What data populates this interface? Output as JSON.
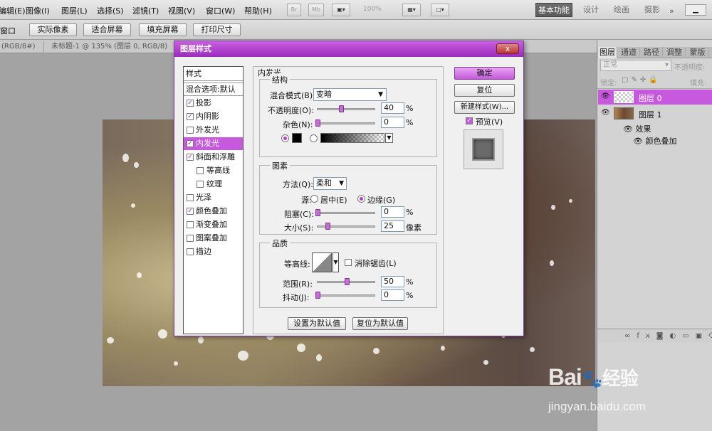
{
  "menubar": {
    "items": [
      "编辑(E)",
      "图像(I)",
      "图层(L)",
      "选择(S)",
      "滤镜(T)",
      "视图(V)",
      "窗口(W)",
      "帮助(H)"
    ],
    "zoom": "100%",
    "workspaces": [
      "基本功能",
      "设计",
      "绘画",
      "摄影"
    ]
  },
  "options": {
    "left_label": "窗口",
    "buttons": [
      "实际像素",
      "适合屏幕",
      "填充屏幕",
      "打印尺寸"
    ]
  },
  "tabs": {
    "first": "(RGB/8#)",
    "second": "未标题-1 @ 135% (图层 0, RGB/8)"
  },
  "panel": {
    "tabs": [
      "图层",
      "通道",
      "路径",
      "调整",
      "蒙版"
    ],
    "blend": "正常",
    "opacity_label": "不透明度:",
    "lock_label": "锁定:",
    "fill_label": "填充:",
    "layers": [
      {
        "name": "图层 0"
      },
      {
        "name": "图层 1"
      }
    ],
    "effects_label": "效果",
    "effect_item": "颜色叠加",
    "footer_icons": [
      "link-icon",
      "fx-icon",
      "mask-icon",
      "adjustment-icon",
      "folder-icon",
      "new-layer-icon",
      "trash-icon"
    ]
  },
  "dialog": {
    "title": "图层样式",
    "close": "x",
    "styles_header": "样式",
    "blend_options": "混合选项:默认",
    "items": [
      {
        "label": "投影",
        "checked": true,
        "sub": false
      },
      {
        "label": "内阴影",
        "checked": true,
        "sub": false
      },
      {
        "label": "外发光",
        "checked": false,
        "sub": false
      },
      {
        "label": "内发光",
        "checked": true,
        "sub": false,
        "selected": true
      },
      {
        "label": "斜面和浮雕",
        "checked": true,
        "sub": false
      },
      {
        "label": "等高线",
        "checked": false,
        "sub": true
      },
      {
        "label": "纹理",
        "checked": false,
        "sub": true
      },
      {
        "label": "光泽",
        "checked": false,
        "sub": false
      },
      {
        "label": "颜色叠加",
        "checked": true,
        "sub": false
      },
      {
        "label": "渐变叠加",
        "checked": false,
        "sub": false
      },
      {
        "label": "图案叠加",
        "checked": false,
        "sub": false
      },
      {
        "label": "描边",
        "checked": false,
        "sub": false
      }
    ],
    "section_title": "内发光",
    "structure": {
      "title": "结构",
      "blend_mode_label": "混合模式(B):",
      "blend_mode": "变暗",
      "opacity_label": "不透明度(O):",
      "opacity": "40",
      "opacity_pct": 40,
      "noise_label": "杂色(N):",
      "noise": "0",
      "noise_pct": 0,
      "pct": "%"
    },
    "elements": {
      "title": "图素",
      "method_label": "方法(Q):",
      "method": "柔和",
      "source_label": "源:",
      "center": "居中(E)",
      "edge": "边缘(G)",
      "choke_label": "阻塞(C):",
      "choke": "0",
      "choke_pct": 0,
      "size_label": "大小(S):",
      "size": "25",
      "size_pct": 17,
      "px": "像素"
    },
    "quality": {
      "title": "品质",
      "contour_label": "等高线:",
      "antialias": "消除锯齿(L)",
      "range_label": "范围(R):",
      "range": "50",
      "range_pct": 50,
      "jitter_label": "抖动(J):",
      "jitter": "0",
      "jitter_pct": 0
    },
    "buttons": {
      "set_default": "设置为默认值",
      "reset_default": "复位为默认值",
      "ok": "确定",
      "reset": "复位",
      "new_style": "新建样式(W)...",
      "preview": "预览(V)"
    }
  },
  "watermark": {
    "brand": "Bai",
    "brand2": "经验",
    "site": "jingyan.baidu.com"
  },
  "colors": {
    "accent": "#c659dd",
    "title": "#a133c4"
  }
}
